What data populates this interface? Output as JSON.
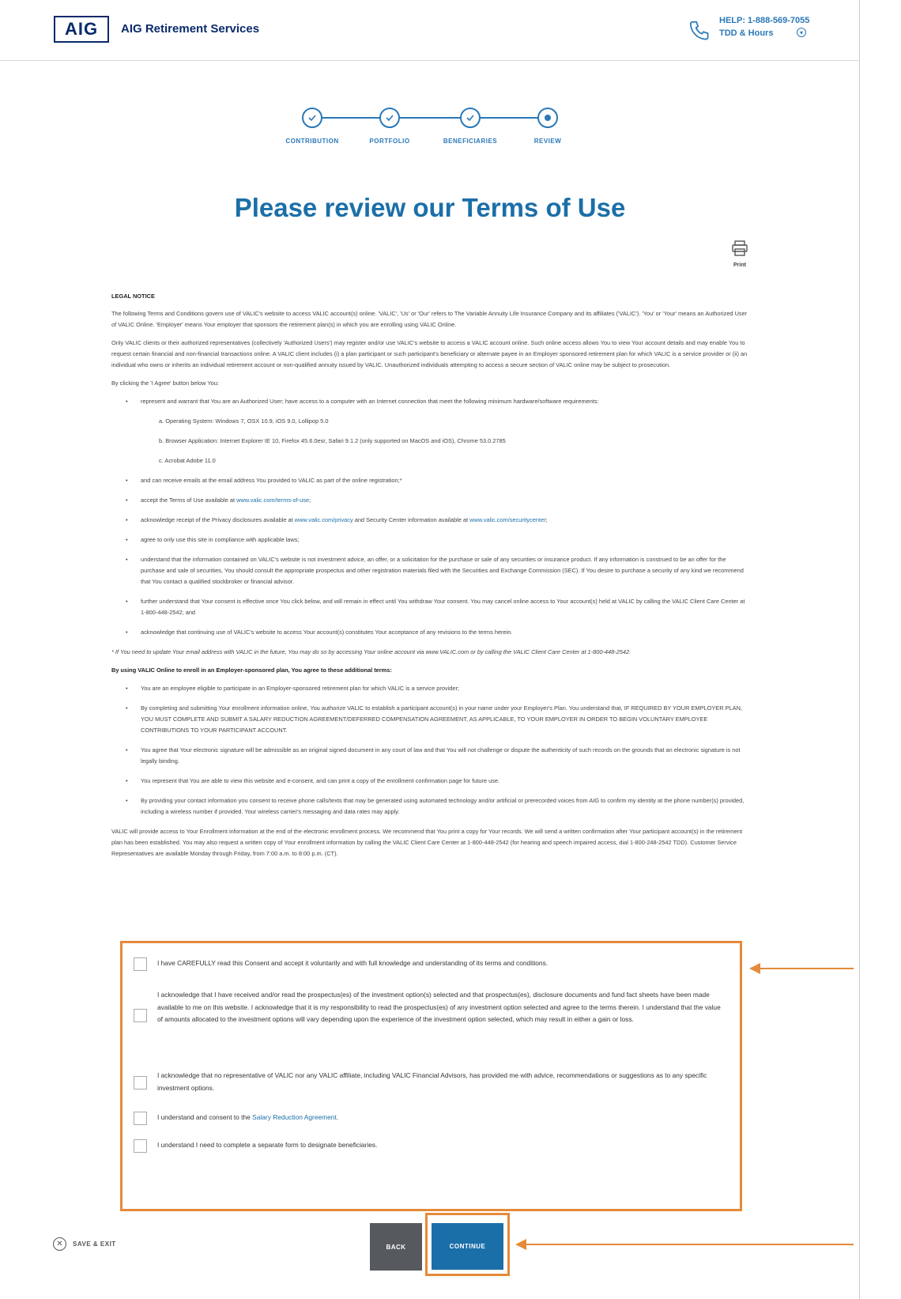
{
  "header": {
    "logo": "AIG",
    "brand": "AIG Retirement Services",
    "help_line1": "HELP: 1-888-569-7055",
    "help_line2": "TDD & Hours"
  },
  "stepper": {
    "steps": [
      {
        "label": "CONTRIBUTION",
        "state": "complete"
      },
      {
        "label": "PORTFOLIO",
        "state": "complete"
      },
      {
        "label": "BENEFICIARIES",
        "state": "complete"
      },
      {
        "label": "REVIEW",
        "state": "current"
      }
    ]
  },
  "title": "Please review our Terms of Use",
  "print_label": "Print",
  "legal": {
    "heading": "LEGAL NOTICE",
    "p1": "The following Terms and Conditions govern use of VALIC's website to access VALIC account(s) online. 'VALIC', 'Us' or 'Our' refers to The Variable Annuity Life Insurance Company and its affiliates ('VALIC'). 'You' or 'Your' means an Authorized User of VALIC Online. 'Employer' means Your employer that sponsors the retirement plan(s) in which you are enrolling using VALIC Online.",
    "p2": "Only VALIC clients or their authorized representatives (collectively 'Authorized Users') may register and/or use VALIC's website to access a VALIC account online. Such online access allows You to view Your account details and may enable You to request certain financial and non-financial transactions online. A VALIC client includes (i) a plan participant or such participant's beneficiary or alternate payee in an Employer sponsored retirement plan for which VALIC is a service provider or (ii) an individual who owns or inherits an individual retirement account or non-qualified annuity issued by VALIC. Unauthorized individuals attempting to access a secure section of VALIC online may be subject to prosecution.",
    "p3": "By clicking the 'I Agree' button below You:",
    "b1": "represent and warrant that You are an Authorized User; have access to a computer with an Internet connection that meet the following minimum hardware/software requirements:",
    "s1": "a.  Operating System: Windows 7, OSX 10.9, iOS 9.0, Lollipop 5.0",
    "s2": "b.  Browser Application: Internet Explorer IE 10, Firefox 45.6.0esr, Safari 9.1.2 (only supported on MacOS and iOS), Chrome 53.0.2785",
    "s3": "c.  Acrobat Adobe 11.0",
    "b2": "and can receive emails at the email address You provided to VALIC as part of the online registration;*",
    "b3_pre": "accept the Terms of Use available at ",
    "b3_link": "www.valic.com/terms-of-use",
    "b3_post": ";",
    "b4_pre": "acknowledge receipt of the Privacy disclosures available at ",
    "b4_link1": "www.valic.com/privacy",
    "b4_mid": " and Security Center information available at ",
    "b4_link2": "www.valic.com/securitycenter",
    "b4_post": ";",
    "b5": "agree to only use this site in compliance with applicable laws;",
    "b6": "understand that the information contained on VALIC's website is not investment advice, an offer, or a solicitation for the purchase or sale of any securities or insurance product. If any information is construed to be an offer for the purchase and sale of securities, You should consult the appropriate prospectus and other registration materials filed with the Securities and Exchange Commission (SEC). If You desire to purchase a security of any kind we recommend that You contact a qualified stockbroker or financial advisor.",
    "b7": "further understand that Your consent is effective once You click below, and will remain in effect until You withdraw Your consent. You may cancel online access to Your account(s) held at VALIC by calling the VALIC Client Care Center at 1-800-448-2542; and",
    "b8": "acknowledge that continuing use of VALIC's website to access Your account(s) constitutes Your acceptance of any revisions to the terms herein.",
    "footnote": "* If You need to update Your email address with VALIC in the future, You may do so by accessing Your online account via www.VALIC.com or by calling the VALIC Client Care Center at 1-800-448-2542.",
    "enroll_heading": "By using VALIC Online to enroll in an Employer-sponsored plan, You agree to these additional terms:",
    "e1": "You are an employee eligible to participate in an Employer-sponsored retirement plan for which VALIC is a service provider;",
    "e2": "By completing and submitting Your enrollment information online, You authorize VALIC to establish a participant account(s) in your name under your Employer's Plan. You understand that, IF REQUIRED BY YOUR EMPLOYER PLAN, YOU MUST COMPLETE AND SUBMIT A SALARY REDUCTION AGREEMENT/DEFERRED COMPENSATION AGREEMENT, AS APPLICABLE, TO YOUR EMPLOYER IN ORDER TO BEGIN VOLUNTARY EMPLOYEE CONTRIBUTIONS TO YOUR PARTICIPANT ACCOUNT.",
    "e3": "You agree that Your electronic signature will be admissible as an original signed document in any court of law and that You will not challenge or dispute the authenticity of such records on the grounds that an electronic signature is not legally binding.",
    "e4": "You represent that You are able to view this website and e-consent, and can print a copy of the enrollment confirmation page for future use.",
    "e5": "By providing your contact information you consent to receive phone calls/texts that may be generated using automated technology and/or artificial or prerecorded voices from AIG to confirm my identity at the phone number(s) provided, including a wireless number if provided. Your wireless carrier's messaging and data rates may apply.",
    "closing": "VALIC will provide access to Your Enrollment information at the end of the electronic enrollment process. We recommend that You print a copy for Your records. We will send a written confirmation after Your participant account(s) in the retirement plan has been established. You may also request a written copy of Your enrollment information by calling the VALIC Client Care Center at 1-800-448-2542 (for hearing and speech impaired access, dial 1-800-248-2542 TDD). Customer Service Representatives are available Monday through Friday, from 7:00 a.m. to 8:00 p.m. (CT)."
  },
  "consents": [
    {
      "text": "I have CAREFULLY read this Consent and accept it voluntarily and with full knowledge and understanding of its terms and conditions."
    },
    {
      "text": "I acknowledge that I have received and/or read the prospectus(es) of the investment option(s) selected and that prospectus(es), disclosure documents and fund fact sheets have been made available to me on this website. I acknowledge that it is my responsibility to read the prospectus(es) of any investment option selected and agree to the terms therein. I understand that the value of amounts allocated to the investment options will vary depending upon the experience of the investment option selected, which may result in either a gain or loss."
    },
    {
      "text": "I acknowledge that no representative of VALIC nor any VALIC affiliate, including VALIC Financial Advisors, has provided me with advice, recommendations or suggestions as to any specific investment options."
    },
    {
      "text_pre": "I understand and consent to the ",
      "link": "Salary Reduction Agreement",
      "text_post": "."
    },
    {
      "text": "I understand I need to complete a separate form to designate beneficiaries."
    }
  ],
  "footer": {
    "save_exit": "SAVE & EXIT",
    "back": "BACK",
    "continue": "CONTINUE"
  },
  "colors": {
    "brand_blue": "#1b6fa8",
    "navy": "#0a2a6b",
    "highlight_orange": "#e58a3a",
    "back_gray": "#565a5f"
  }
}
